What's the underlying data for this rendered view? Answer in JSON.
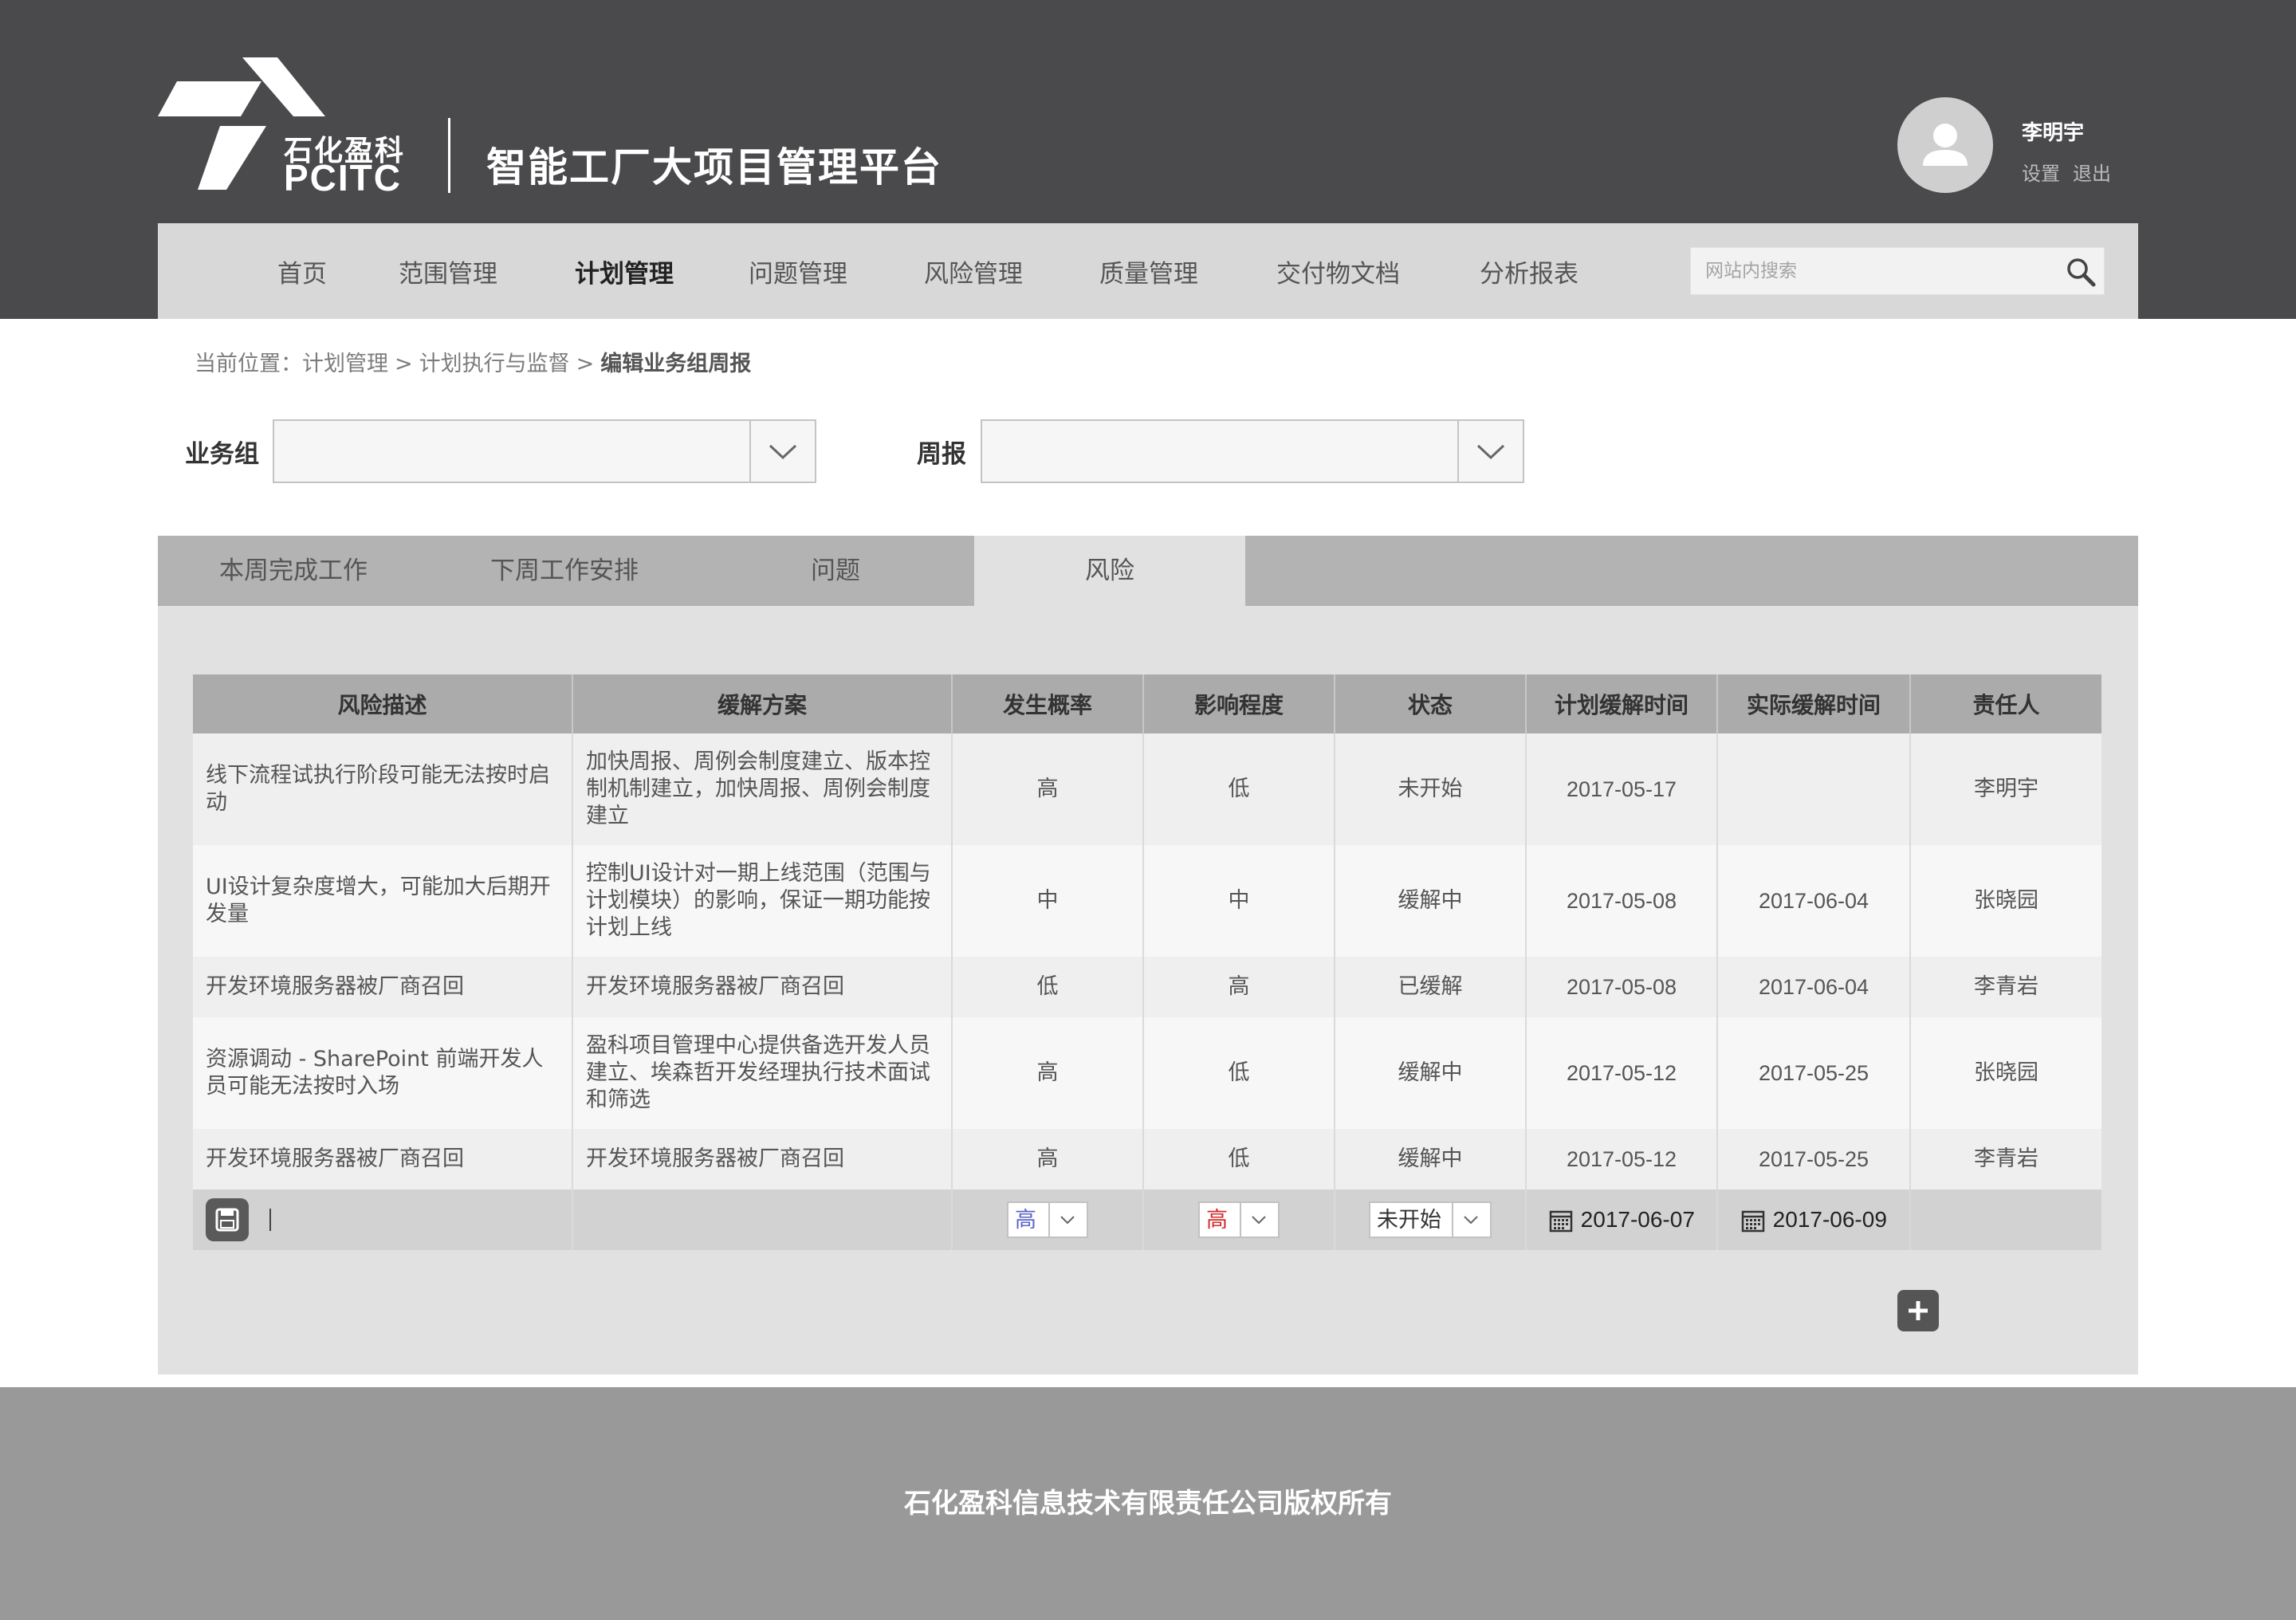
{
  "brand": {
    "logo_cn": "石化盈科",
    "logo_en": "PCITC",
    "platform_title": "智能工厂大项目管理平台"
  },
  "user": {
    "name": "李明宇",
    "settings_label": "设置",
    "logout_label": "退出"
  },
  "nav": {
    "items": [
      {
        "label": "首页"
      },
      {
        "label": "范围管理"
      },
      {
        "label": "计划管理"
      },
      {
        "label": "问题管理"
      },
      {
        "label": "风险管理"
      },
      {
        "label": "质量管理"
      },
      {
        "label": "交付物文档"
      },
      {
        "label": "分析报表"
      }
    ],
    "active": "计划管理",
    "search_placeholder": "网站内搜索"
  },
  "breadcrumb": {
    "prefix": "当前位置：",
    "items": [
      "计划管理",
      "计划执行与监督",
      "编辑业务组周报"
    ],
    "separator": ">"
  },
  "filters": {
    "group_label": "业务组",
    "group_value": "",
    "report_label": "周报",
    "report_value": ""
  },
  "tabs": {
    "items": [
      "本周完成工作",
      "下周工作安排",
      "问题",
      "风险"
    ],
    "active": "风险"
  },
  "risk_table": {
    "columns": [
      "风险描述",
      "缓解方案",
      "发生概率",
      "影响程度",
      "状态",
      "计划缓解时间",
      "实际缓解时间",
      "责任人"
    ],
    "rows": [
      {
        "description": "线下流程试执行阶段可能无法按时启动",
        "mitigation": "加快周报、周例会制度建立、版本控制机制建立，加快周报、周例会制度建立",
        "probability": "高",
        "impact": "低",
        "status": "未开始",
        "planned_date": "2017-05-17",
        "actual_date": "",
        "owner": "李明宇"
      },
      {
        "description": "UI设计复杂度增大，可能加大后期开发量",
        "mitigation": "控制UI设计对一期上线范围（范围与计划模块）的影响，保证一期功能按计划上线",
        "probability": "中",
        "impact": "中",
        "status": "缓解中",
        "planned_date": "2017-05-08",
        "actual_date": "2017-06-04",
        "owner": "张晓园"
      },
      {
        "description": "开发环境服务器被厂商召回",
        "mitigation": "开发环境服务器被厂商召回",
        "probability": "低",
        "impact": "高",
        "status": "已缓解",
        "planned_date": "2017-05-08",
        "actual_date": "2017-06-04",
        "owner": "李青岩"
      },
      {
        "description": "资源调动 - SharePoint 前端开发人员可能无法按时入场",
        "mitigation": "盈科项目管理中心提供备选开发人员建立、埃森哲开发经理执行技术面试和筛选",
        "probability": "高",
        "impact": "低",
        "status": "缓解中",
        "planned_date": "2017-05-12",
        "actual_date": "2017-05-25",
        "owner": "张晓园"
      },
      {
        "description": "开发环境服务器被厂商召回",
        "mitigation": "开发环境服务器被厂商召回",
        "probability": "高",
        "impact": "低",
        "status": "缓解中",
        "planned_date": "2017-05-12",
        "actual_date": "2017-05-25",
        "owner": "李青岩"
      }
    ],
    "edit_row": {
      "description": "",
      "mitigation": "",
      "probability": "高",
      "impact": "高",
      "status": "未开始",
      "planned_date": "2017-06-07",
      "actual_date": "2017-06-09",
      "owner": ""
    }
  },
  "footer": {
    "copyright": "石化盈科信息技术有限责任公司版权所有"
  },
  "colors": {
    "header_bg": "#4a4a4c",
    "nav_bg": "#d8d8d8",
    "panel_bg": "#e1e1e1",
    "footer_bg": "#999999",
    "level_blue": "#5b63c9",
    "level_red": "#a0172a"
  },
  "icons": [
    "user-avatar-icon",
    "search-icon",
    "chevron-down-icon",
    "save-icon",
    "calendar-icon",
    "plus-icon"
  ]
}
